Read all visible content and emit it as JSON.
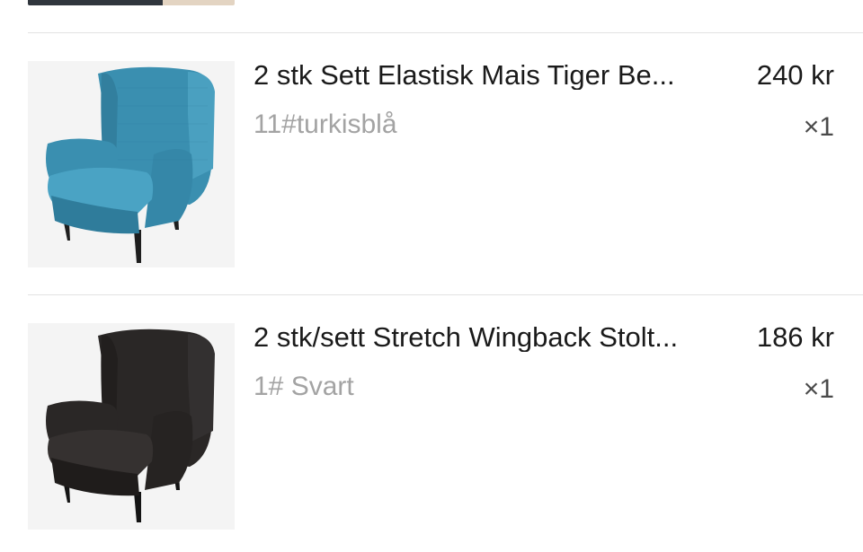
{
  "items": [
    {
      "title": "2 stk Sett Elastisk Mais Tiger Be...",
      "price": "240 kr",
      "variant": "11#turkisblå",
      "quantity": "×1",
      "image": "turquoise-wingback-chair",
      "color": "#3a8fb0"
    },
    {
      "title": "2 stk/sett Stretch Wingback Stolt...",
      "price": "186 kr",
      "variant": "1# Svart",
      "quantity": "×1",
      "image": "black-wingback-chair",
      "color": "#2a2726"
    }
  ]
}
